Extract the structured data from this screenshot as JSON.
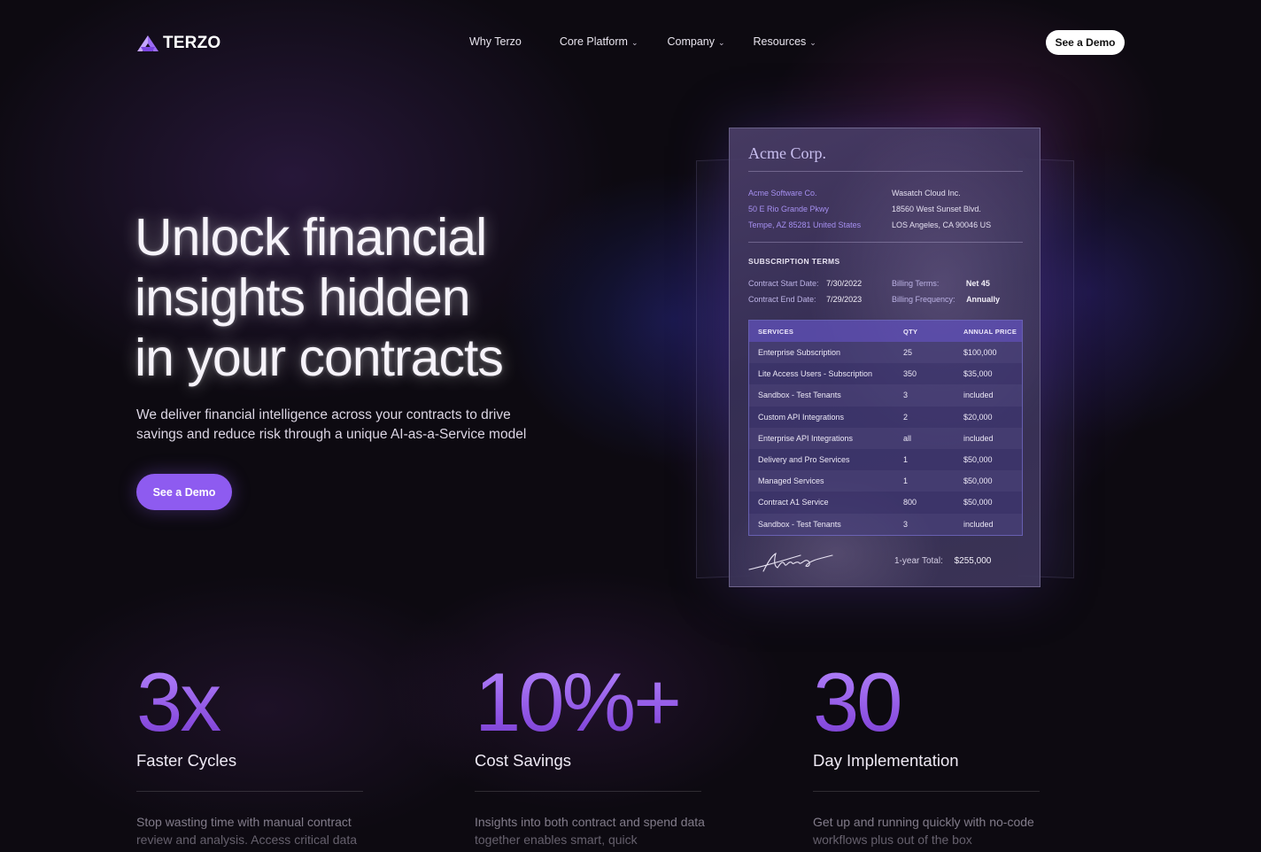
{
  "nav": {
    "logo_text": "TERZO",
    "links": [
      {
        "label": "Why Terzo",
        "dropdown": false
      },
      {
        "label": "Core Platform",
        "dropdown": true
      },
      {
        "label": "Company",
        "dropdown": true
      },
      {
        "label": "Resources",
        "dropdown": true
      }
    ],
    "demo_label": "See a Demo"
  },
  "hero": {
    "title_lines": [
      "Unlock financial",
      "insights hidden",
      "in your contracts"
    ],
    "subtitle": "We deliver financial intelligence across your contracts to drive savings and reduce risk through a unique AI-as-a-Service model",
    "cta_label": "See a Demo"
  },
  "contract": {
    "company": "Acme Corp.",
    "from": [
      "Acme Software Co.",
      "50 E Rio Grande Pkwy",
      "Tempe, AZ 85281 United States"
    ],
    "to": [
      "Wasatch Cloud Inc.",
      "18560 West Sunset Blvd.",
      "LOS Angeles, CA 90046 US"
    ],
    "terms_heading": "SUBSCRIPTION TERMS",
    "terms": {
      "start_key": "Contract Start Date:",
      "start_val": "7/30/2022",
      "end_key": "Contract End Date:",
      "end_val": "7/29/2023",
      "billing_terms_key": "Billing Terms:",
      "billing_terms_val": "Net 45",
      "billing_freq_key": "Billing Frequency:",
      "billing_freq_val": "Annually"
    },
    "table_headers": [
      "SERVICES",
      "QTY",
      "ANNUAL PRICE"
    ],
    "rows": [
      {
        "name": "Enterprise Subscription",
        "qty": "25",
        "price": "$100,000"
      },
      {
        "name": "Lite Access Users - Subscription",
        "qty": "350",
        "price": "$35,000"
      },
      {
        "name": "Sandbox - Test Tenants",
        "qty": "3",
        "price": "included"
      },
      {
        "name": "Custom API Integrations",
        "qty": "2",
        "price": "$20,000"
      },
      {
        "name": "Enterprise API Integrations",
        "qty": "all",
        "price": "included"
      },
      {
        "name": "Delivery and Pro Services",
        "qty": "1",
        "price": "$50,000"
      },
      {
        "name": "Managed Services",
        "qty": "1",
        "price": "$50,000"
      },
      {
        "name": "Contract A1 Service",
        "qty": "800",
        "price": "$50,000"
      },
      {
        "name": "Sandbox - Test Tenants",
        "qty": "3",
        "price": "included"
      }
    ],
    "total_label": "1-year Total:",
    "total_value": "$255,000"
  },
  "stats": [
    {
      "number": "3x",
      "label": "Faster Cycles",
      "desc": "Stop wasting time with manual contract review and analysis. Access critical data"
    },
    {
      "number": "10%+",
      "label": "Cost Savings",
      "desc": "Insights into both contract and spend data together enables smart, quick"
    },
    {
      "number": "30",
      "label": "Day Implementation",
      "desc": "Get up and running quickly with no-code workflows plus out of the box"
    }
  ],
  "colors": {
    "background": "#0d0a11",
    "accent": "#8e5bf0",
    "stat_gradient_top": "#b98cff",
    "stat_gradient_bottom": "#6f3bc4"
  }
}
